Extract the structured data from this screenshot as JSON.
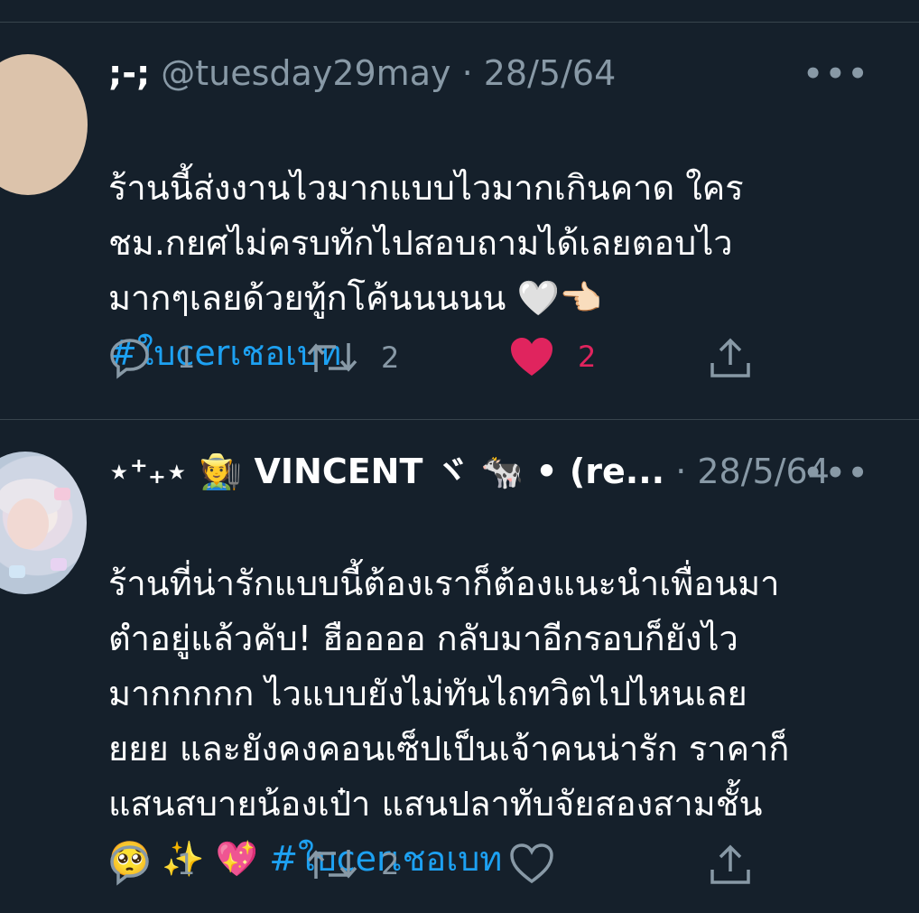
{
  "tweets": [
    {
      "display_name": ";-;",
      "handle": "@tuesday29may",
      "separator": "·",
      "date": "28/5/64",
      "text": "ร้านนี้ส่งงานไวมากแบบไวมากเกินคาด ใคร\nชม.กยศไม่ครบทักไปสอบถามได้เลยตอบไว\nมากๆเลยด้วยทู้กโค้นนนนน 🤍👈🏻",
      "hashtag": "#ใบcerเชอเบท",
      "replies": "1",
      "retweets": "2",
      "likes": "2",
      "liked": true
    },
    {
      "display_name": "⋆⁺₊⋆ 🧑‍🌾 VINCENT ヾ 🐄 • (re...",
      "separator": "·",
      "date": "28/5/64",
      "text": "ร้านที่น่ารักแบบนี้ต้องเราก็ต้องแนะนำเพื่อนมา\nตำอยู่แล้วคับ! ฮืออออ กลับมาอีกรอบก็ยังไว\nมากกกกก ไวแบบยังไม่ทันไถทวิตไปไหนเลย\nยยย และยังคงคอนเซ็ปเป็นเจ้าคนน่ารัก ราคาก็\nแสนสบายน้องเป๋า แสนปลาทับจัยสองสามชั้น\n🥺 ✨ 💖 ",
      "hashtag": "#ใบcerเชอเบท",
      "replies": "1",
      "retweets": "2",
      "likes": "",
      "liked": false
    }
  ],
  "icons": {
    "more": "more-icon",
    "reply": "reply-icon",
    "retweet": "retweet-icon",
    "like": "heart-icon",
    "share": "share-icon"
  },
  "colors": {
    "background": "#15202b",
    "secondary_text": "#8899a6",
    "hashtag": "#1da1f2",
    "like": "#e0245e"
  }
}
